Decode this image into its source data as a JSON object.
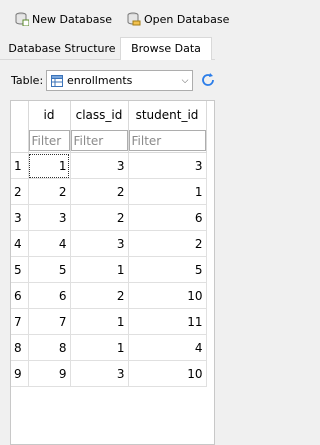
{
  "toolbar": {
    "new_database": "New Database",
    "open_database": "Open Database"
  },
  "tabs": [
    {
      "label": "Database Structure",
      "active": false
    },
    {
      "label": "Browse Data",
      "active": true
    }
  ],
  "browse": {
    "table_label": "Table:",
    "selected_table": "enrollments"
  },
  "grid": {
    "columns": [
      "id",
      "class_id",
      "student_id"
    ],
    "filter_placeholder": "Filter",
    "rows": [
      {
        "num": "1",
        "cells": [
          "1",
          "3",
          "3"
        ]
      },
      {
        "num": "2",
        "cells": [
          "2",
          "2",
          "1"
        ]
      },
      {
        "num": "3",
        "cells": [
          "3",
          "2",
          "6"
        ]
      },
      {
        "num": "4",
        "cells": [
          "4",
          "3",
          "2"
        ]
      },
      {
        "num": "5",
        "cells": [
          "5",
          "1",
          "5"
        ]
      },
      {
        "num": "6",
        "cells": [
          "6",
          "2",
          "10"
        ]
      },
      {
        "num": "7",
        "cells": [
          "7",
          "1",
          "11"
        ]
      },
      {
        "num": "8",
        "cells": [
          "8",
          "1",
          "4"
        ]
      },
      {
        "num": "9",
        "cells": [
          "9",
          "3",
          "10"
        ]
      }
    ]
  },
  "icons": {
    "new_database": "new-database-icon",
    "open_database": "open-database-icon",
    "table": "table-icon",
    "refresh": "refresh-icon",
    "dropdown": "chevron-down-icon"
  },
  "colors": {
    "accent": "#2b7de9",
    "window_bg": "#f0f0f0"
  }
}
